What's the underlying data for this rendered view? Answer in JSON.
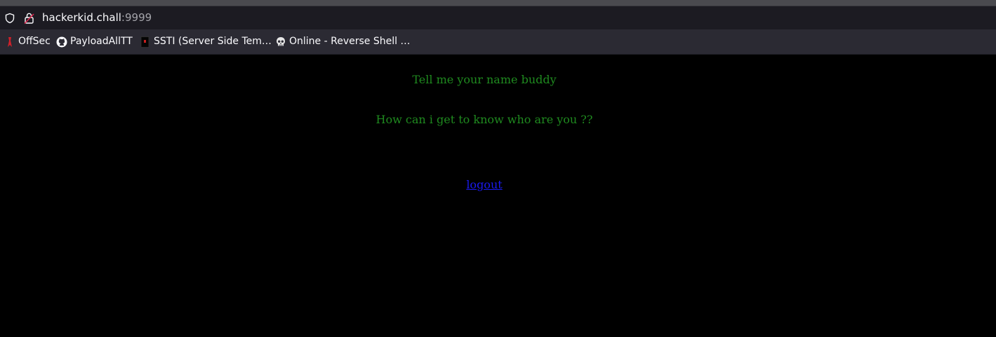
{
  "browser": {
    "url_host": "hackerkid.chall",
    "url_port": ":9999",
    "bookmarks": [
      {
        "label": "OffSec",
        "icon": "offsec-icon"
      },
      {
        "label": "PayloadAllTT",
        "icon": "github-icon"
      },
      {
        "label": "SSTI (Server Side Tem…",
        "icon": "bookmark-icon"
      },
      {
        "label": "Online - Reverse Shell …",
        "icon": "skull-icon"
      }
    ]
  },
  "page": {
    "line1": "Tell me your name buddy",
    "line2": "How can i get to know who are you ??",
    "logout_label": "logout"
  },
  "colors": {
    "page_text": "#1f8a1f",
    "link": "#1a1aee",
    "background": "#000000"
  }
}
